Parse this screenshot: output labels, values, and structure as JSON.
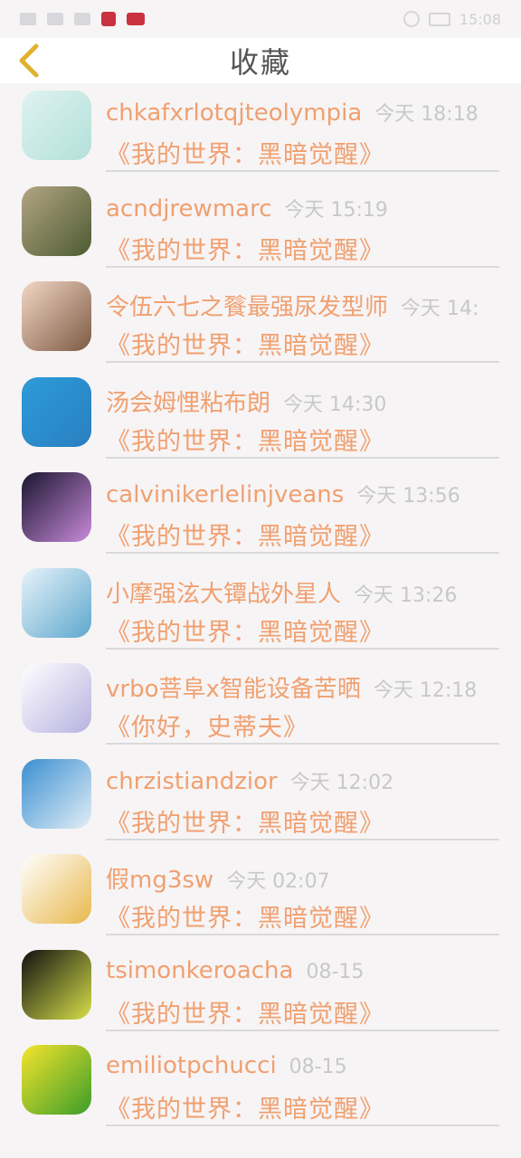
{
  "status_bar": {
    "signal_icon": "signal-icon",
    "wifi_icon": "wifi-icon",
    "app_icon_1": "reader-app-icon",
    "app_icon_2": "news-app-icon",
    "time": "15:08"
  },
  "header": {
    "back_icon": "chevron-left-icon",
    "title": "收藏",
    "accent_color": "#f0a070",
    "back_color": "#e0b230"
  },
  "items": [
    {
      "name": "chkafxrlotqjteolympia",
      "time": "今天 18:18",
      "book": "《我的世界：黑暗觉醒》",
      "avatar_colors": [
        "#dff3f2",
        "#b3e0d8"
      ]
    },
    {
      "name": "acndjrewmarc",
      "time": "今天 15:19",
      "book": "《我的世界：黑暗觉醒》",
      "avatar_colors": [
        "#b2a582",
        "#4d5b33"
      ]
    },
    {
      "name": "令伍六七之餮最强尿发型师",
      "time": "今天 14:",
      "book": "《我的世界：黑暗觉醒》",
      "avatar_colors": [
        "#f3d6c5",
        "#7d5b44"
      ]
    },
    {
      "name": "汤会姆悝粘布朗",
      "time": "今天 14:30",
      "book": "《我的世界：黑暗觉醒》",
      "avatar_colors": [
        "#2c9bd9",
        "#2a7fc0"
      ]
    },
    {
      "name": "calvinikerlelinjveans",
      "time": "今天 13:56",
      "book": "《我的世界：黑暗觉醒》",
      "avatar_colors": [
        "#1a1530",
        "#c88ad9"
      ]
    },
    {
      "name": "小摩强泫大镡战外星人",
      "time": "今天 13:26",
      "book": "《我的世界：黑暗觉醒》",
      "avatar_colors": [
        "#e7f3fa",
        "#5ea7cd"
      ]
    },
    {
      "name": "vrbo菩阜x智能设备苦晒",
      "time": "今天 12:18",
      "book": "《你好，史蒂夫》",
      "avatar_colors": [
        "#ffffff",
        "#b7b2e0"
      ]
    },
    {
      "name": "chrzistiandzior",
      "time": "今天 12:02",
      "book": "《我的世界：黑暗觉醒》",
      "avatar_colors": [
        "#3a8fd1",
        "#e2eef6"
      ]
    },
    {
      "name": "假mg3sw",
      "time": "今天 02:07",
      "book": "《我的世界：黑暗觉醒》",
      "avatar_colors": [
        "#ffffff",
        "#e8b84c"
      ]
    },
    {
      "name": "tsimonkeroacha",
      "time": "08-15",
      "book": "《我的世界：黑暗觉醒》",
      "avatar_colors": [
        "#101010",
        "#d7e04a"
      ]
    },
    {
      "name": "emiliotpchucci",
      "time": "08-15",
      "book": "《我的世界：黑暗觉醒》",
      "avatar_colors": [
        "#f5e42c",
        "#3b9d2a"
      ]
    }
  ]
}
